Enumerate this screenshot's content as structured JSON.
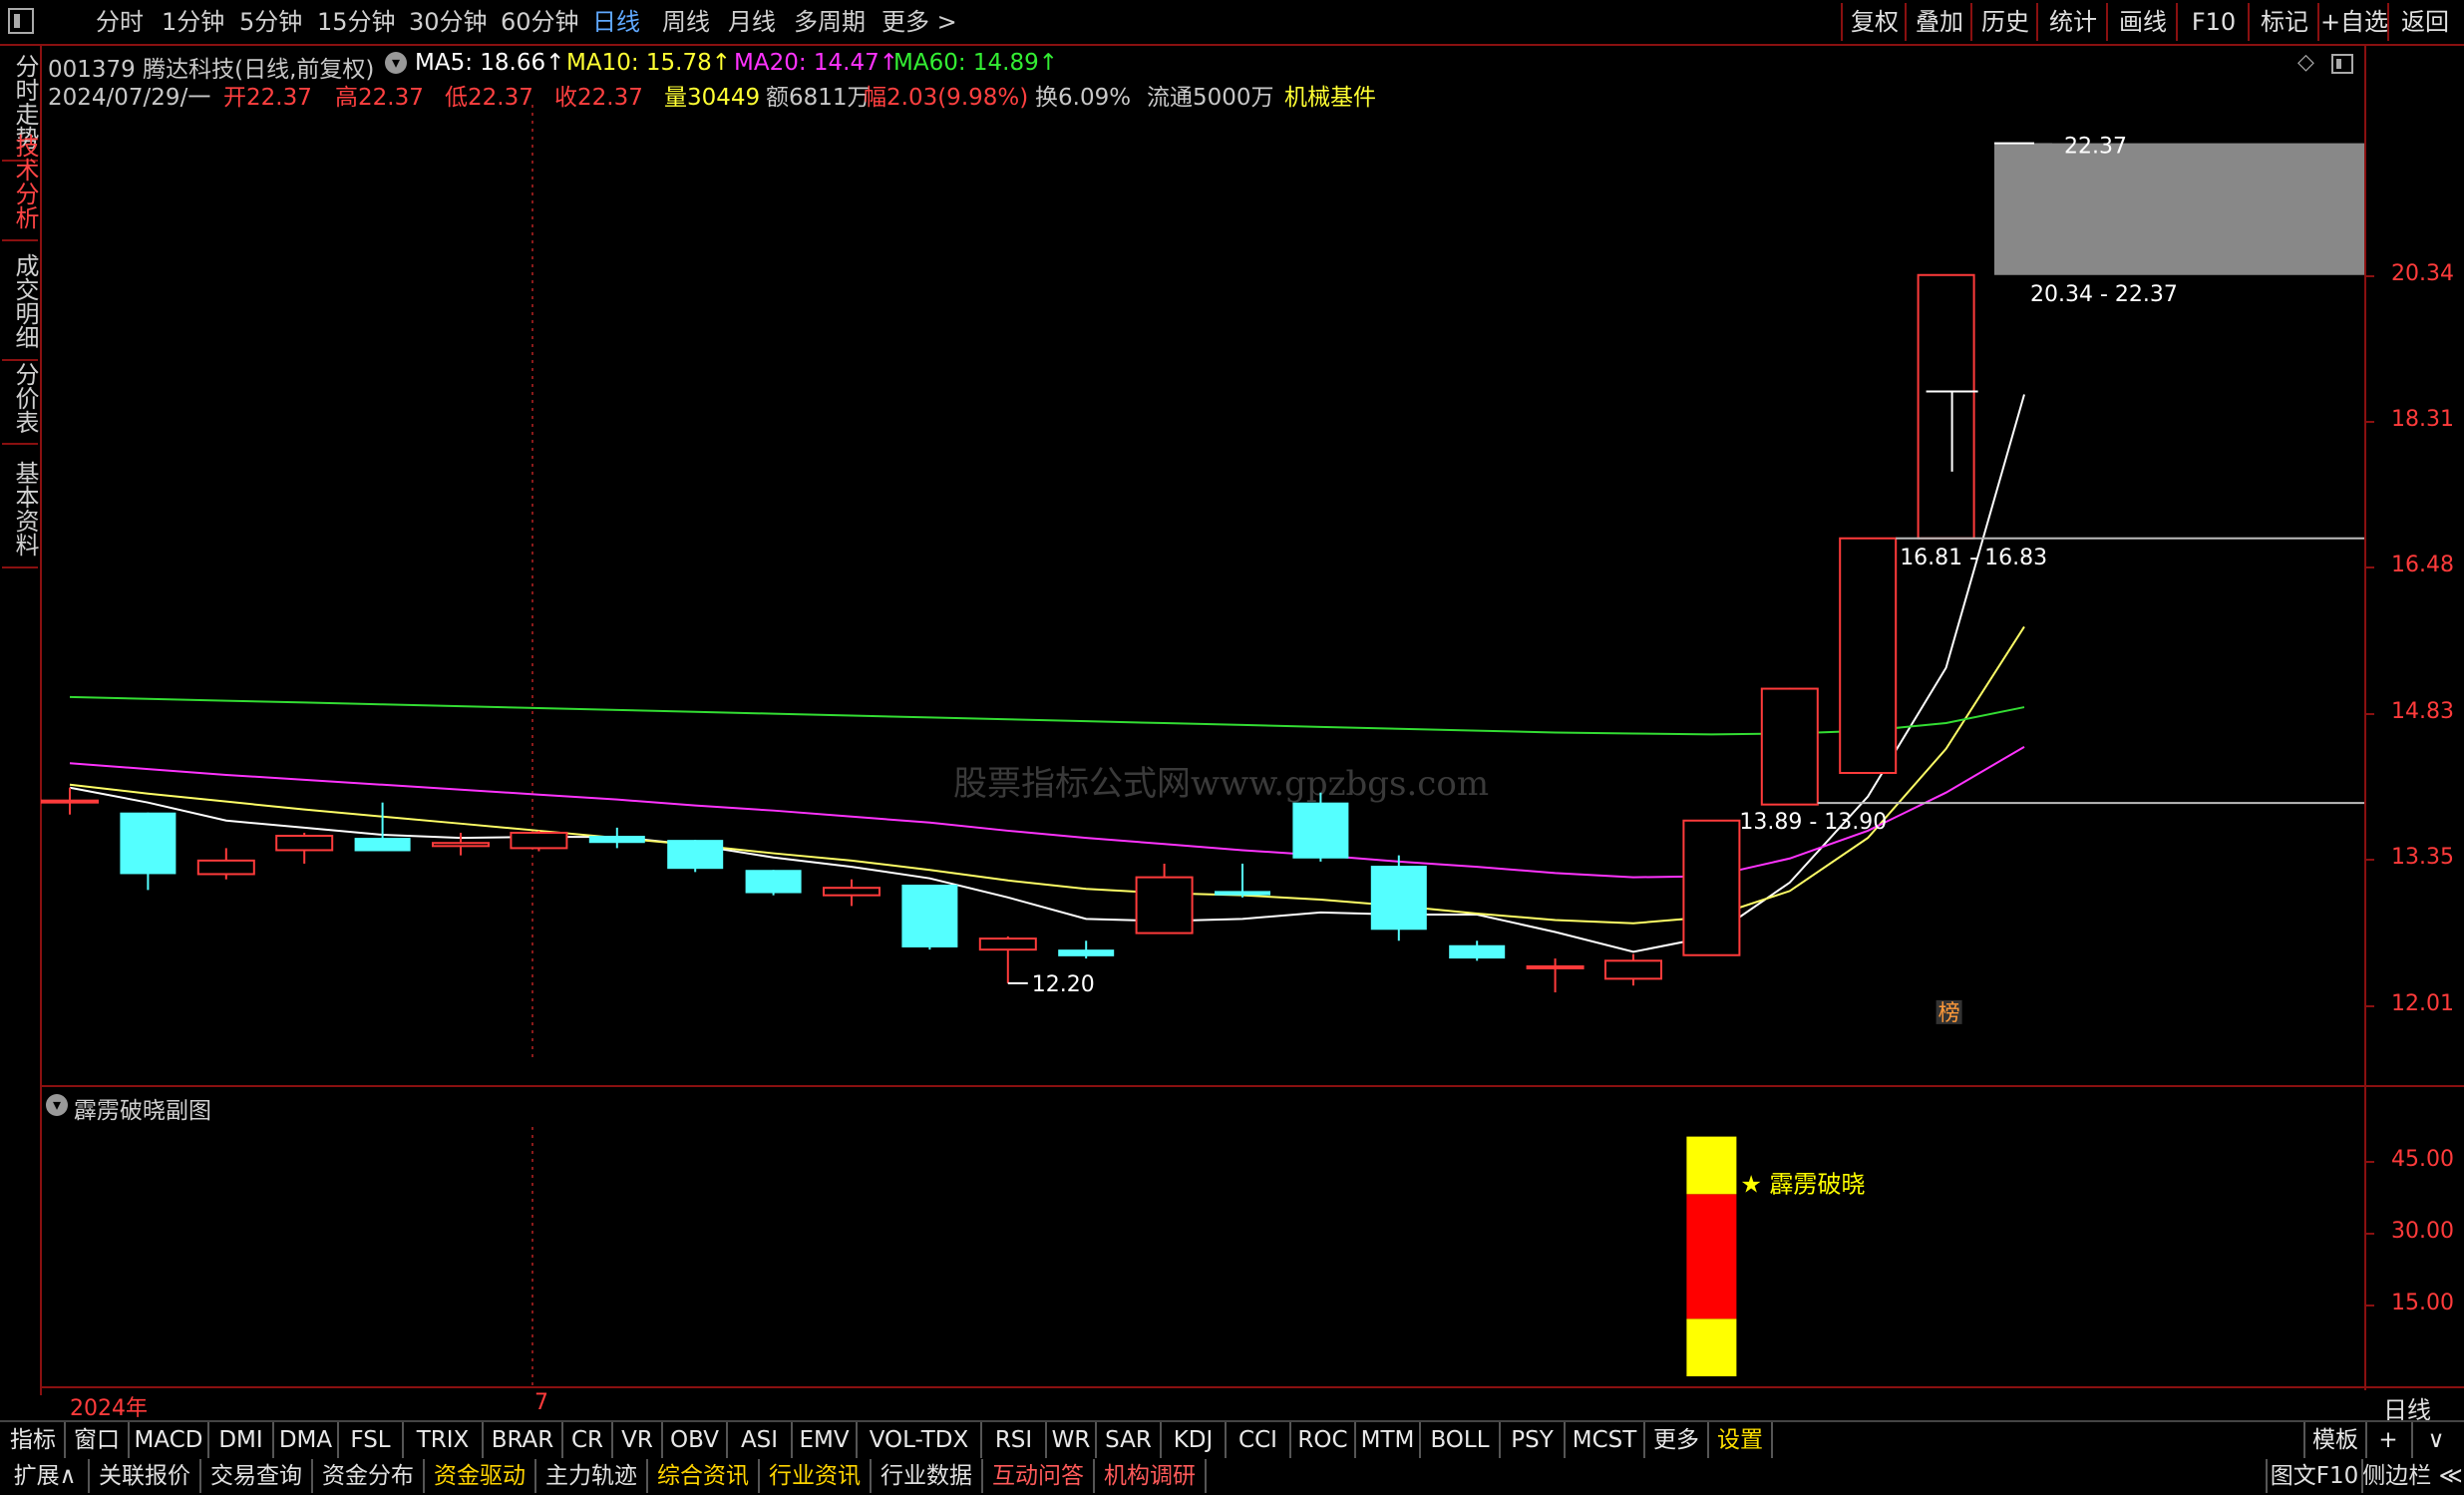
{
  "toolbar": {
    "periods": [
      {
        "label": "分时"
      },
      {
        "label": "1分钟"
      },
      {
        "label": "5分钟"
      },
      {
        "label": "15分钟"
      },
      {
        "label": "30分钟"
      },
      {
        "label": "60分钟"
      },
      {
        "label": "日线",
        "active": true
      },
      {
        "label": "周线"
      },
      {
        "label": "月线"
      },
      {
        "label": "多周期"
      },
      {
        "label": "更多 >"
      }
    ],
    "right_buttons": [
      {
        "label": "复权"
      },
      {
        "label": "叠加"
      },
      {
        "label": "历史"
      },
      {
        "label": "统计"
      },
      {
        "label": "画线"
      },
      {
        "label": "F10"
      },
      {
        "label": "标记"
      },
      {
        "label": "+自选"
      },
      {
        "label": "返回"
      }
    ]
  },
  "left_tabs": [
    {
      "label": "分时走势"
    },
    {
      "label": "技术分析",
      "active": true
    },
    {
      "label": "成交明细"
    },
    {
      "label": "分价表"
    },
    {
      "label": "基本资料"
    }
  ],
  "stock": {
    "code_name": "001379 腾达科技(日线,前复权)",
    "ma5": "MA5: 18.66↑",
    "ma10": "MA10: 15.78↑",
    "ma20": "MA20: 14.47↑",
    "ma60": "MA60: 14.89↑",
    "date": "2024/07/29/一",
    "open": "开22.37",
    "high": "高22.37",
    "low": "低22.37",
    "close": "收22.37",
    "volume": "量30449",
    "amount": "额6811万",
    "change": "幅2.03(9.98%)",
    "turnover": "换6.09%",
    "float": "流通5000万",
    "industry": "机械基件"
  },
  "watermark": "股票指标公式网www.gpzbgs.com",
  "main_axis": {
    "ticks": [
      "20.34",
      "18.31",
      "16.48",
      "14.83",
      "13.35",
      "12.01"
    ]
  },
  "annotations": {
    "high_mark": "22.37",
    "low_mark": "12.20",
    "zone1": "20.34 - 22.37",
    "zone2": "16.81 - 16.83",
    "zone3": "13.89 - 13.90",
    "badge": "榜"
  },
  "sub_chart": {
    "title": "霹雳破晓副图",
    "signal_label": "★ 霹雳破晓",
    "ticks": [
      "45.00",
      "30.00",
      "15.00"
    ]
  },
  "time_axis": {
    "year": "2024年",
    "month": "7",
    "period": "日线"
  },
  "indicator_tabs": [
    {
      "label": "指标"
    },
    {
      "label": "窗口"
    },
    {
      "label": "MACD"
    },
    {
      "label": "DMI"
    },
    {
      "label": "DMA"
    },
    {
      "label": "FSL"
    },
    {
      "label": "TRIX"
    },
    {
      "label": "BRAR"
    },
    {
      "label": "CR"
    },
    {
      "label": "VR"
    },
    {
      "label": "OBV"
    },
    {
      "label": "ASI"
    },
    {
      "label": "EMV"
    },
    {
      "label": "VOL-TDX"
    },
    {
      "label": "RSI"
    },
    {
      "label": "WR"
    },
    {
      "label": "SAR"
    },
    {
      "label": "KDJ"
    },
    {
      "label": "CCI"
    },
    {
      "label": "ROC"
    },
    {
      "label": "MTM"
    },
    {
      "label": "BOLL"
    },
    {
      "label": "PSY"
    },
    {
      "label": "MCST"
    },
    {
      "label": "更多"
    },
    {
      "label": "设置",
      "active": true
    }
  ],
  "indicator_right": {
    "template": "模板",
    "plus": "+",
    "chevron": "∨"
  },
  "function_tabs": [
    {
      "label": "扩展∧",
      "c": "w"
    },
    {
      "label": "关联报价",
      "c": "w"
    },
    {
      "label": "交易查询",
      "c": "w"
    },
    {
      "label": "资金分布",
      "c": "w"
    },
    {
      "label": "资金驱动",
      "c": "y"
    },
    {
      "label": "主力轨迹",
      "c": "w"
    },
    {
      "label": "综合资讯",
      "c": "y"
    },
    {
      "label": "行业资讯",
      "c": "y"
    },
    {
      "label": "行业数据",
      "c": "w"
    },
    {
      "label": "互动问答",
      "c": "r"
    },
    {
      "label": "机构调研",
      "c": "r"
    }
  ],
  "function_right": {
    "f10": "图文F10",
    "sidebar": "侧边栏 ≪"
  },
  "chart_data": {
    "type": "candlestick",
    "price_axis_range": [
      11.5,
      23.0
    ],
    "candles": [
      {
        "o": 13.92,
        "h": 14.05,
        "l": 13.78,
        "c": 13.92
      },
      {
        "o": 13.8,
        "h": 13.8,
        "l": 13.05,
        "c": 13.2
      },
      {
        "o": 13.2,
        "h": 13.45,
        "l": 13.15,
        "c": 13.33
      },
      {
        "o": 13.43,
        "h": 13.6,
        "l": 13.3,
        "c": 13.57
      },
      {
        "o": 13.55,
        "h": 13.9,
        "l": 13.45,
        "c": 13.42
      },
      {
        "o": 13.47,
        "h": 13.6,
        "l": 13.38,
        "c": 13.5
      },
      {
        "o": 13.45,
        "h": 13.62,
        "l": 13.42,
        "c": 13.6
      },
      {
        "o": 13.57,
        "h": 13.65,
        "l": 13.45,
        "c": 13.5
      },
      {
        "o": 13.53,
        "h": 13.53,
        "l": 13.22,
        "c": 13.25
      },
      {
        "o": 13.24,
        "h": 13.24,
        "l": 13.0,
        "c": 13.02
      },
      {
        "o": 13.0,
        "h": 13.15,
        "l": 12.9,
        "c": 13.07
      },
      {
        "o": 13.1,
        "h": 13.1,
        "l": 12.5,
        "c": 12.52
      },
      {
        "o": 12.5,
        "h": 12.62,
        "l": 12.2,
        "c": 12.6
      },
      {
        "o": 12.5,
        "h": 12.58,
        "l": 12.42,
        "c": 12.44
      },
      {
        "o": 12.65,
        "h": 13.3,
        "l": 12.65,
        "c": 13.17
      },
      {
        "o": 13.04,
        "h": 13.3,
        "l": 12.98,
        "c": 13.0
      },
      {
        "o": 13.9,
        "h": 14.0,
        "l": 13.32,
        "c": 13.35
      },
      {
        "o": 13.28,
        "h": 13.38,
        "l": 12.58,
        "c": 12.68
      },
      {
        "o": 12.54,
        "h": 12.58,
        "l": 12.4,
        "c": 12.42
      },
      {
        "o": 12.35,
        "h": 12.42,
        "l": 12.12,
        "c": 12.35
      },
      {
        "o": 12.24,
        "h": 12.46,
        "l": 12.18,
        "c": 12.4
      },
      {
        "o": 12.45,
        "h": 13.72,
        "l": 12.45,
        "c": 13.72
      },
      {
        "o": 13.88,
        "h": 15.1,
        "l": 13.88,
        "c": 15.09
      },
      {
        "o": 14.2,
        "h": 16.82,
        "l": 14.2,
        "c": 16.82
      },
      {
        "o": 16.82,
        "h": 20.34,
        "l": 16.82,
        "c": 20.34
      },
      {
        "o": 22.37,
        "h": 22.37,
        "l": 22.37,
        "c": 22.37
      }
    ],
    "ma": [
      {
        "name": "MA5",
        "color": "#ffffff",
        "values": [
          14.05,
          13.9,
          13.72,
          13.65,
          13.58,
          13.55,
          13.56,
          13.56,
          13.48,
          13.36,
          13.27,
          13.16,
          12.98,
          12.78,
          12.76,
          12.78,
          12.84,
          12.82,
          12.82,
          12.66,
          12.48,
          12.62,
          13.12,
          13.96,
          15.32,
          18.66
        ]
      },
      {
        "name": "MA10",
        "color": "#ffff66",
        "values": [
          14.08,
          13.99,
          13.91,
          13.83,
          13.76,
          13.69,
          13.62,
          13.55,
          13.48,
          13.4,
          13.33,
          13.24,
          13.14,
          13.06,
          13.02,
          13.0,
          12.96,
          12.9,
          12.83,
          12.77,
          12.74,
          12.8,
          13.04,
          13.55,
          14.45,
          15.78
        ]
      },
      {
        "name": "MA20",
        "color": "#ff33ff",
        "values": [
          14.3,
          14.24,
          14.18,
          14.13,
          14.08,
          14.03,
          13.98,
          13.93,
          13.87,
          13.82,
          13.76,
          13.7,
          13.62,
          13.55,
          13.49,
          13.43,
          13.38,
          13.32,
          13.27,
          13.21,
          13.17,
          13.18,
          13.35,
          13.62,
          14.0,
          14.47
        ]
      },
      {
        "name": "MA60",
        "color": "#33dd33",
        "values": [
          15.0,
          14.98,
          14.96,
          14.94,
          14.92,
          14.9,
          14.88,
          14.86,
          14.84,
          14.82,
          14.8,
          14.78,
          14.76,
          14.74,
          14.72,
          14.7,
          14.68,
          14.66,
          14.64,
          14.62,
          14.61,
          14.6,
          14.61,
          14.64,
          14.72,
          14.89
        ]
      }
    ],
    "sub_signal": {
      "candle_index": 21,
      "segments": [
        {
          "from": 0,
          "to": 12,
          "color": "#ffff00"
        },
        {
          "from": 12,
          "to": 38,
          "color": "#ff0000"
        },
        {
          "from": 38,
          "to": 50,
          "color": "#ffff00"
        }
      ],
      "axis_range": [
        0,
        52
      ]
    }
  }
}
